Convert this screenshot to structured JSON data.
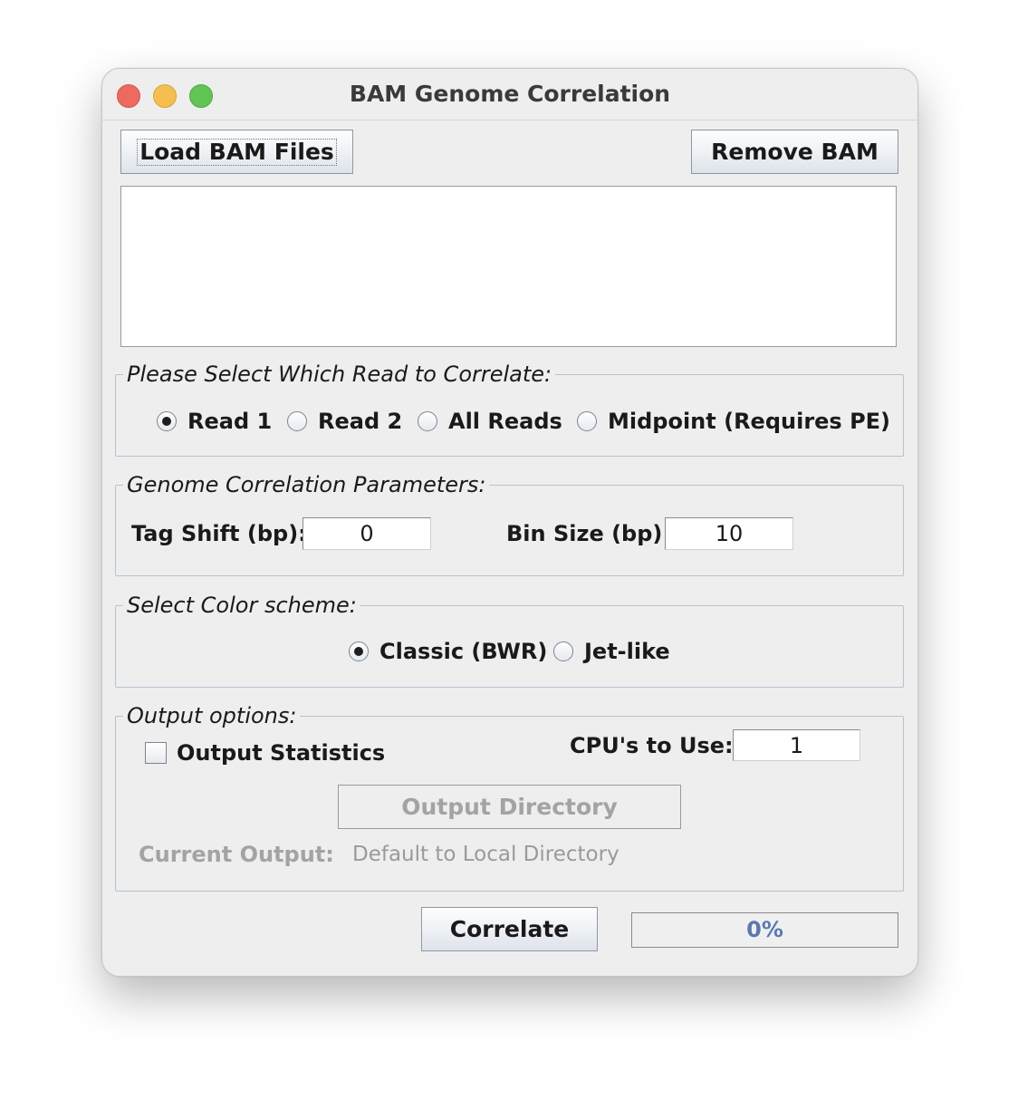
{
  "window": {
    "title": "BAM Genome Correlation"
  },
  "toolbar": {
    "load_label": "Load BAM Files",
    "remove_label": "Remove BAM"
  },
  "file_list": {
    "items": []
  },
  "read_group": {
    "legend": "Please Select Which Read to Correlate:",
    "options": [
      "Read 1",
      "Read 2",
      "All Reads",
      "Midpoint (Requires PE)"
    ],
    "selected": "Read 1"
  },
  "params_group": {
    "legend": "Genome Correlation Parameters:",
    "tag_shift_label": "Tag Shift (bp):",
    "tag_shift_value": "0",
    "bin_size_label": "Bin Size (bp):",
    "bin_size_value": "10"
  },
  "color_group": {
    "legend": "Select Color scheme:",
    "options": [
      "Classic (BWR)",
      "Jet-like"
    ],
    "selected": "Classic (BWR)"
  },
  "output_group": {
    "legend": "Output options:",
    "stats_label": "Output Statistics",
    "stats_checked": false,
    "cpu_label": "CPU's to Use:",
    "cpu_value": "1",
    "dir_button": "Output Directory",
    "current_label": "Current Output:",
    "current_value": "Default to Local Directory"
  },
  "actions": {
    "correlate_label": "Correlate"
  },
  "progress": {
    "text": "0%",
    "value": 0
  },
  "colors": {
    "progress_text": "#5b78b1",
    "group_border": "#b5c3d1"
  }
}
